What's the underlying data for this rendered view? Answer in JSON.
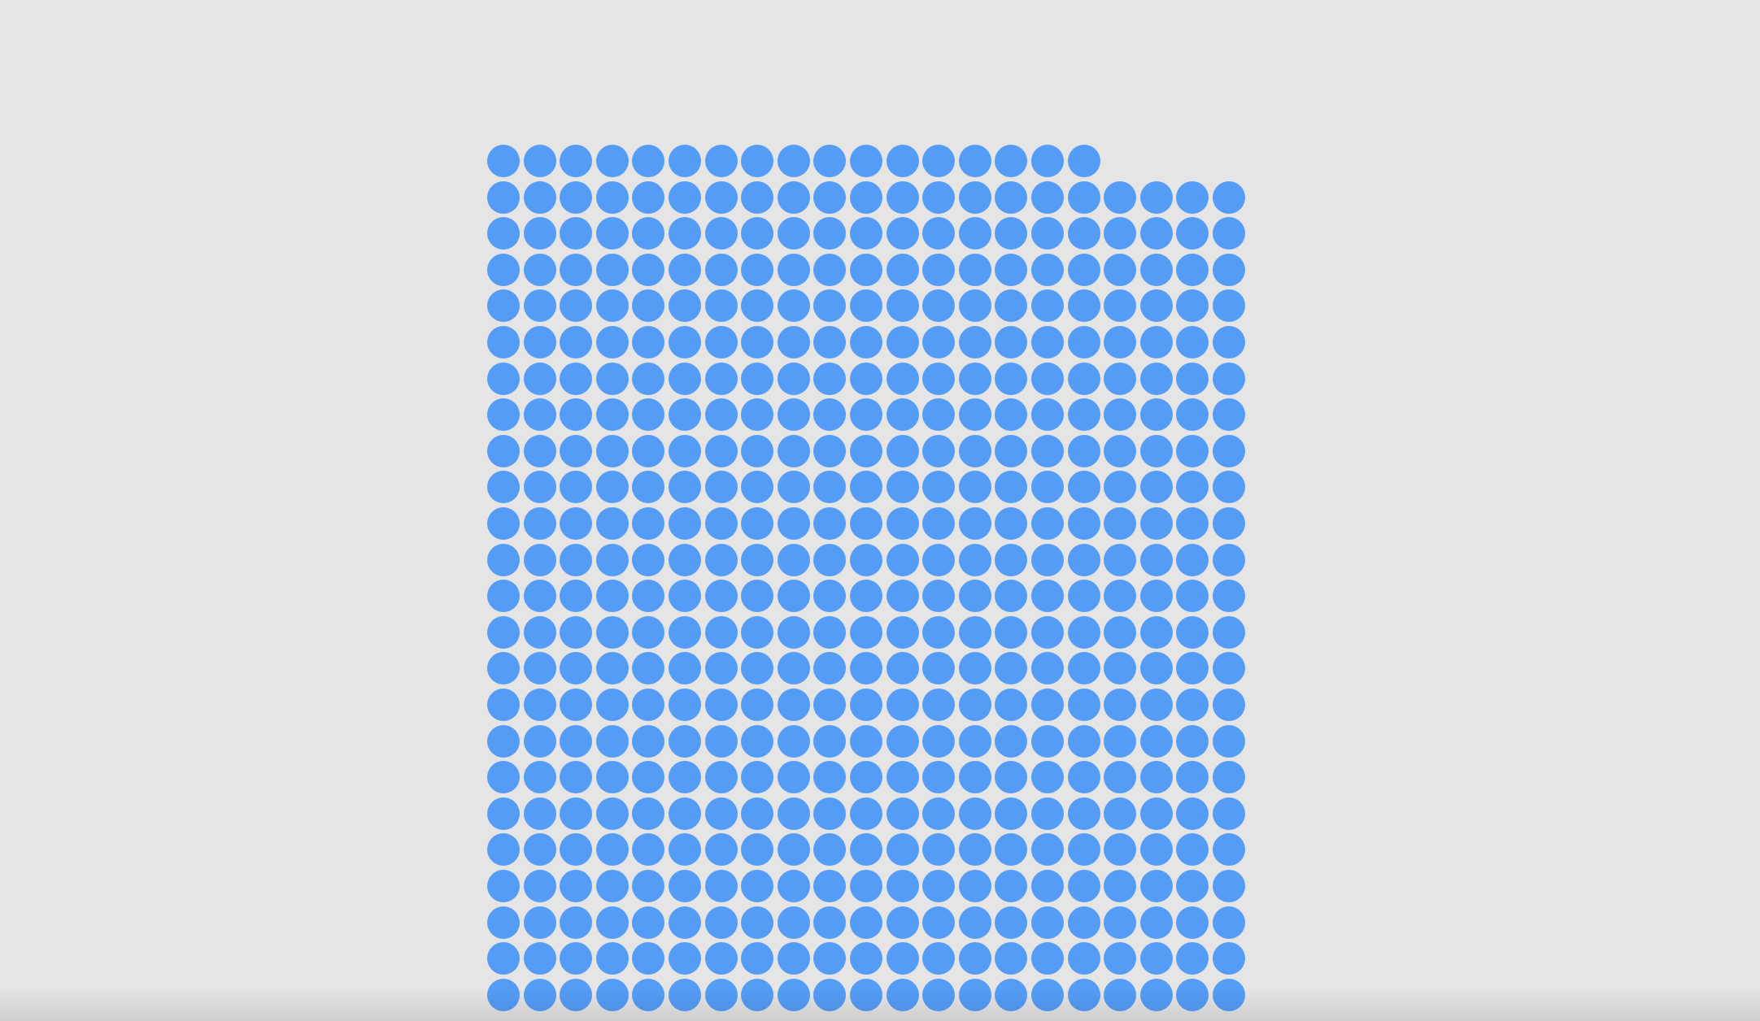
{
  "dot_grid": {
    "rows": 24,
    "columns": 21,
    "first_row_count": 17,
    "total_dots": 500,
    "dot_color": "#559cf6",
    "background_color": "#e5e5e5"
  }
}
